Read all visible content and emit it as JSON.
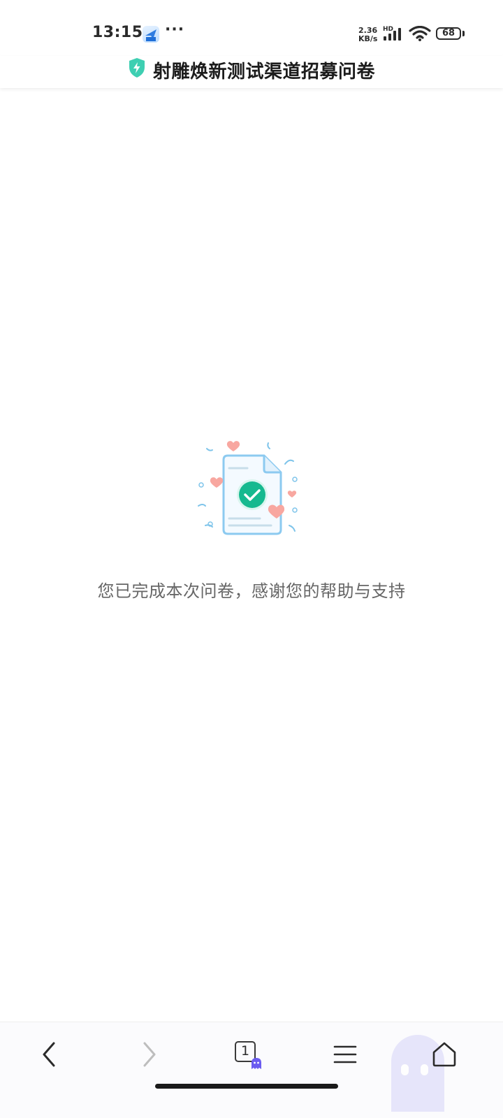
{
  "status_bar": {
    "time": "13:15",
    "more": "···",
    "net_speed_value": "2.36",
    "net_speed_unit": "KB/s",
    "hd": "HD",
    "battery": "68"
  },
  "header": {
    "title": "射雕焕新测试渠道招募问卷",
    "shield_color": "#3ecfb2"
  },
  "result": {
    "message": "您已完成本次问卷，感谢您的帮助与支持",
    "check_color": "#16b98f"
  },
  "bottom_nav": {
    "tab_count": "1",
    "accent": "#6b5cf0"
  }
}
